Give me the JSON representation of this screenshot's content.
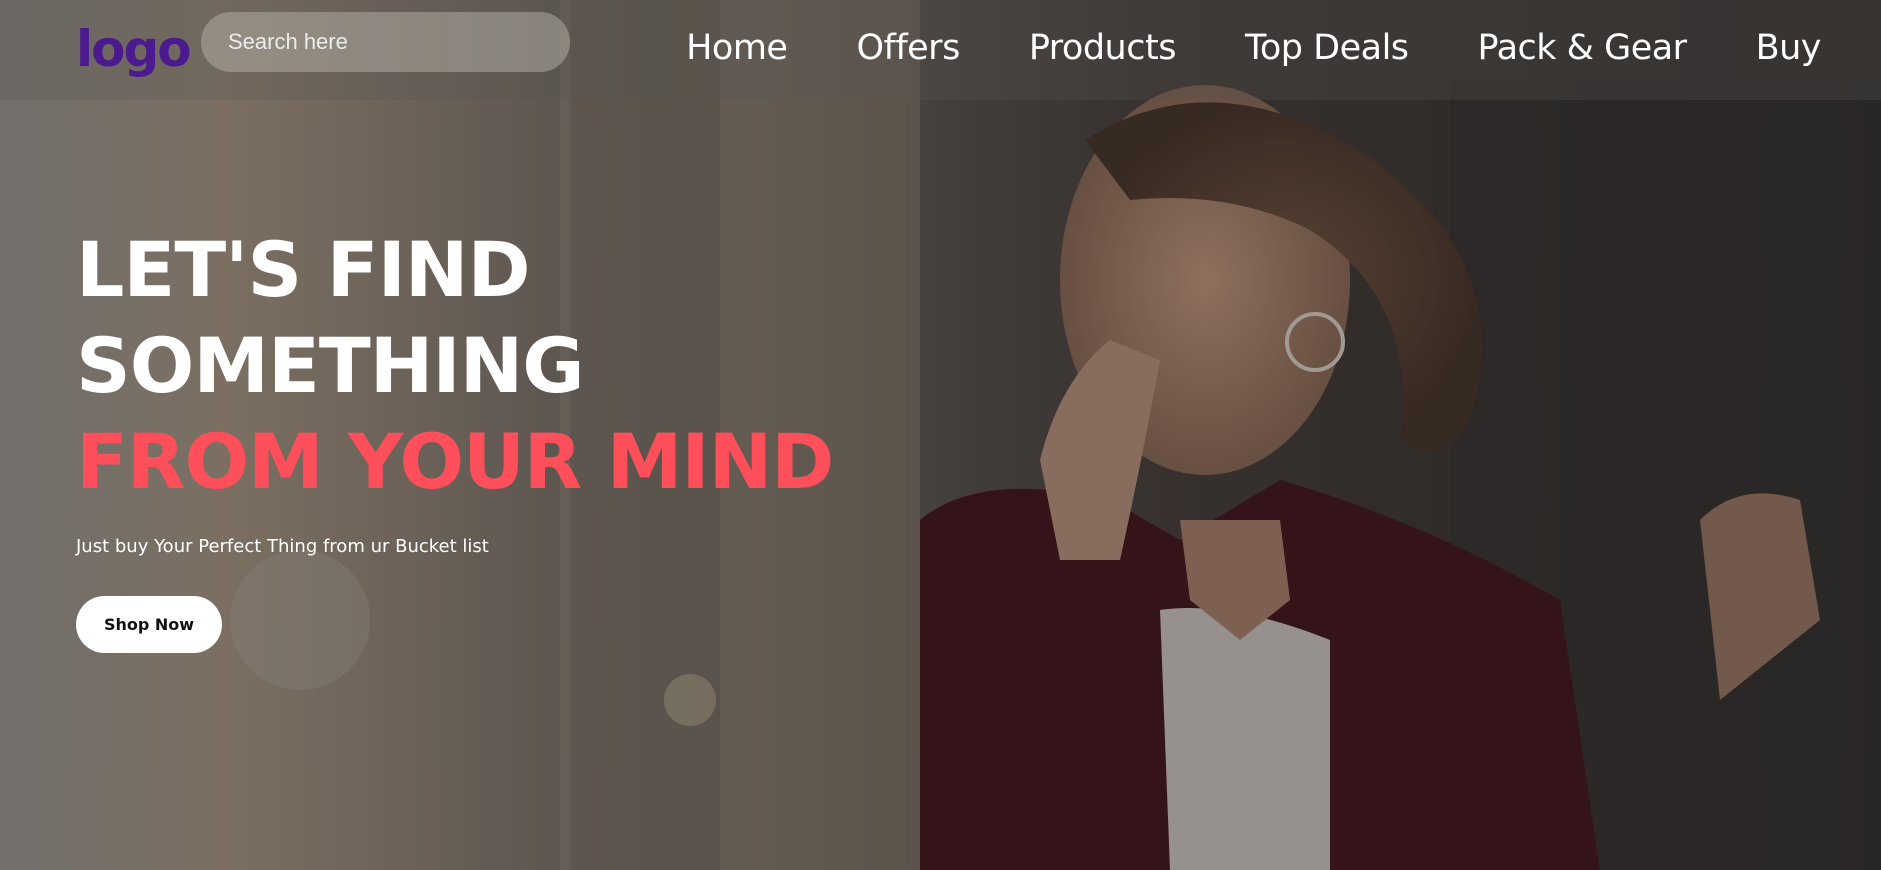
{
  "header": {
    "logo": "logo",
    "search": {
      "placeholder": "Search here",
      "value": ""
    },
    "nav": [
      "Home",
      "Offers",
      "Products",
      "Top Deals",
      "Pack & Gear",
      "Buy"
    ]
  },
  "hero": {
    "headline": [
      "LET'S FIND",
      "SOMETHING",
      "FROM YOUR MIND"
    ],
    "subtitle": "Just buy Your Perfect Thing from ur Bucket list",
    "cta": "Shop Now"
  },
  "colors": {
    "logo": "#4b1a8e",
    "accent": "#ff4f5a",
    "button_bg": "#ffffff",
    "text": "#ffffff"
  }
}
